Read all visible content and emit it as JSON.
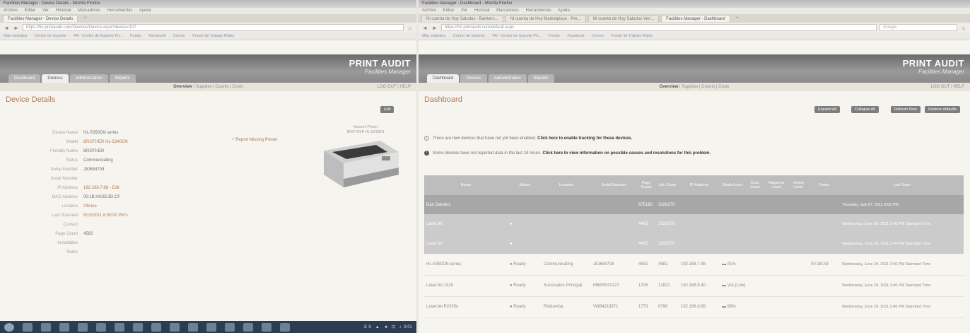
{
  "left": {
    "titlebar": "Facilities Manager - Device Details - Mozilla Firefox",
    "menu": [
      "Archivo",
      "Editar",
      "Ver",
      "Historial",
      "Marcadores",
      "Herramientas",
      "Ayuda"
    ],
    "tabs": [
      {
        "label": "Facilities Manager - Device Details"
      }
    ],
    "newtab": "+",
    "url": "https://fm.printaudit.com/Devices/Device.aspx?device=107",
    "bookmarks": [
      "Más visitados",
      "Centro de Soporte",
      "PA - Centro de Soporte Pri...",
      "Fondo",
      "Facebook",
      "Correo",
      "Fondo de Trabajo Rúbio"
    ],
    "header": {
      "brand1": "PRINT AUDIT",
      "brand2": "Facilities Manager",
      "navtabs": [
        "Dashboard",
        "Devices",
        "Administration",
        "Reports"
      ]
    },
    "subnav": {
      "items": [
        "Overview",
        "Supplies",
        "Counts",
        "Costs"
      ],
      "current": "Overview",
      "right": "LOG OUT | HELP"
    },
    "page_title": "Device Details",
    "edit_label": "Edit",
    "details": [
      {
        "label": "Device Name",
        "value": "HL-5350DN series",
        "link": false
      },
      {
        "label": "Model",
        "value": "BROTHER HL-5340DN",
        "link": true
      },
      {
        "label": "Friendly Name",
        "value": "BROTHER",
        "link": false
      },
      {
        "label": "Status",
        "value": "Communicating",
        "link": false
      },
      {
        "label": "Serial Number",
        "value": "J8J684708",
        "link": false
      },
      {
        "label": "Asset Number",
        "value": "",
        "link": false
      },
      {
        "label": "IP Address",
        "value": "192.168.7.88 - Edit",
        "link": true
      },
      {
        "label": "MAC Address",
        "value": "00:1B:A9:85:3D:CF",
        "link": false
      },
      {
        "label": "Location",
        "value": "Oficina",
        "link": true
      },
      {
        "label": "Last Scanned",
        "value": "6/15/2011 6:30:00 PM",
        "link": true
      },
      {
        "label": "Contact",
        "value": "",
        "link": false
      },
      {
        "label": "Page Count",
        "value": "4582",
        "link": false
      },
      {
        "label": "Installation",
        "value": "",
        "link": false
      },
      {
        "label": "Notes",
        "value": "",
        "link": false
      }
    ],
    "report_link": "Report Missing Printer",
    "printer_caption": "Network Printer\nBROTHER HL-5340DN",
    "taskbar_time": "9:01",
    "taskbar_tray": "ES ▲ ◄ ⊡ ♪"
  },
  "right": {
    "titlebar": "Facilities Manager - Dashboard - Mozilla Firefox",
    "menu": [
      "Archivo",
      "Editar",
      "Ver",
      "Historial",
      "Marcadores",
      "Herramientas",
      "Ayuda"
    ],
    "tabs": [
      {
        "label": "Ni cuenta de Hoy Saludos - Bankers..."
      },
      {
        "label": "Ni cuenta de Hoy Marketplace - Pre..."
      },
      {
        "label": "Ni cuenta de Hoy Saludos Ven..."
      },
      {
        "label": "Facilities Manager - Dashboard"
      }
    ],
    "newtab": "+",
    "url": "https://fm.printaudit.com/default.aspx",
    "search": "Google",
    "bookmarks": [
      "Más visitados",
      "Centro de Soporte",
      "PA - Centro de Soporte Pri...",
      "Fondo",
      "Facebook",
      "Correo",
      "Fondo de Trabajo Rúbio"
    ],
    "header": {
      "brand1": "PRINT AUDIT",
      "brand2": "Facilities Manager",
      "navtabs": [
        "Dashboard",
        "Devices",
        "Administration",
        "Reports"
      ]
    },
    "subnav": {
      "items": [
        "Overview",
        "Supplies",
        "Counts",
        "Costs"
      ],
      "current": "Overview",
      "right": "LOG OUT | HELP"
    },
    "page_title": "Dashboard",
    "buttons": [
      "Expand All",
      "Collapse All",
      "Refresh Now",
      "Restore defaults"
    ],
    "notice1": {
      "text": "There are new devices that have not yet been enabled. ",
      "link": "Click here to enable tracking for these devices."
    },
    "notice2": {
      "text": "Some devices have not reported data in the last 24 hours. ",
      "link": "Click here to view information on possible causes and resolutions for this problem."
    },
    "table": {
      "headers": [
        "Name",
        "Status",
        "Location",
        "Serial Number",
        "Page Count",
        "Life Count",
        "IP Address",
        "Black Level",
        "Cyan Level",
        "Magenta Level",
        "Yellow Level",
        "Notes",
        "Last Scan"
      ],
      "rows": [
        {
          "kind": "group",
          "cells": [
            "Dan Saludos",
            "",
            "",
            "",
            "675180",
            "1028270",
            "",
            "",
            "",
            "",
            "",
            "",
            "Thursday, July 07, 2011 3:03 PM"
          ]
        },
        {
          "kind": "group2",
          "cells": [
            "LaserJet",
            "●",
            "",
            "",
            "4403",
            "1028270",
            "",
            "",
            "",
            "",
            "",
            "",
            "Wednesday, June 29, 2011 2:46 PM Standard Time"
          ]
        },
        {
          "kind": "group2",
          "cells": [
            "LaserJet",
            "●",
            "",
            "",
            "4403",
            "1028270",
            "",
            "",
            "",
            "",
            "",
            "",
            "Wednesday, June 29, 2011 2:46 PM Standard Time"
          ]
        },
        {
          "kind": "data",
          "cells": [
            "HL-5350DN series",
            "● Ready",
            "Communicating",
            "J8J684708",
            "4582",
            "4582",
            "192.168.7.88",
            "▬ 81%",
            "",
            "",
            "",
            "00:1B:A9",
            "Wednesday, June 29, 2011 2:46 PM Standard Time"
          ]
        },
        {
          "kind": "data",
          "cells": [
            "LaserJet 1320",
            "● Ready",
            "Sucursales Principal",
            "M6KR020127",
            "1706",
            "12821",
            "192.168.8.40",
            "▬ Vía (Low)",
            "",
            "",
            "",
            "",
            "Wednesday, June 29, 2011 2:46 PM Standard Time"
          ]
        },
        {
          "kind": "data",
          "cells": [
            "LaserJet P2035n",
            "● Ready",
            "Riobamba",
            "VNB4J18371",
            "1773",
            "6790",
            "192.168.8.88",
            "▬ 99%",
            "",
            "",
            "",
            "",
            "Wednesday, June 29, 2011 2:46 PM Standard Time"
          ]
        }
      ]
    }
  }
}
